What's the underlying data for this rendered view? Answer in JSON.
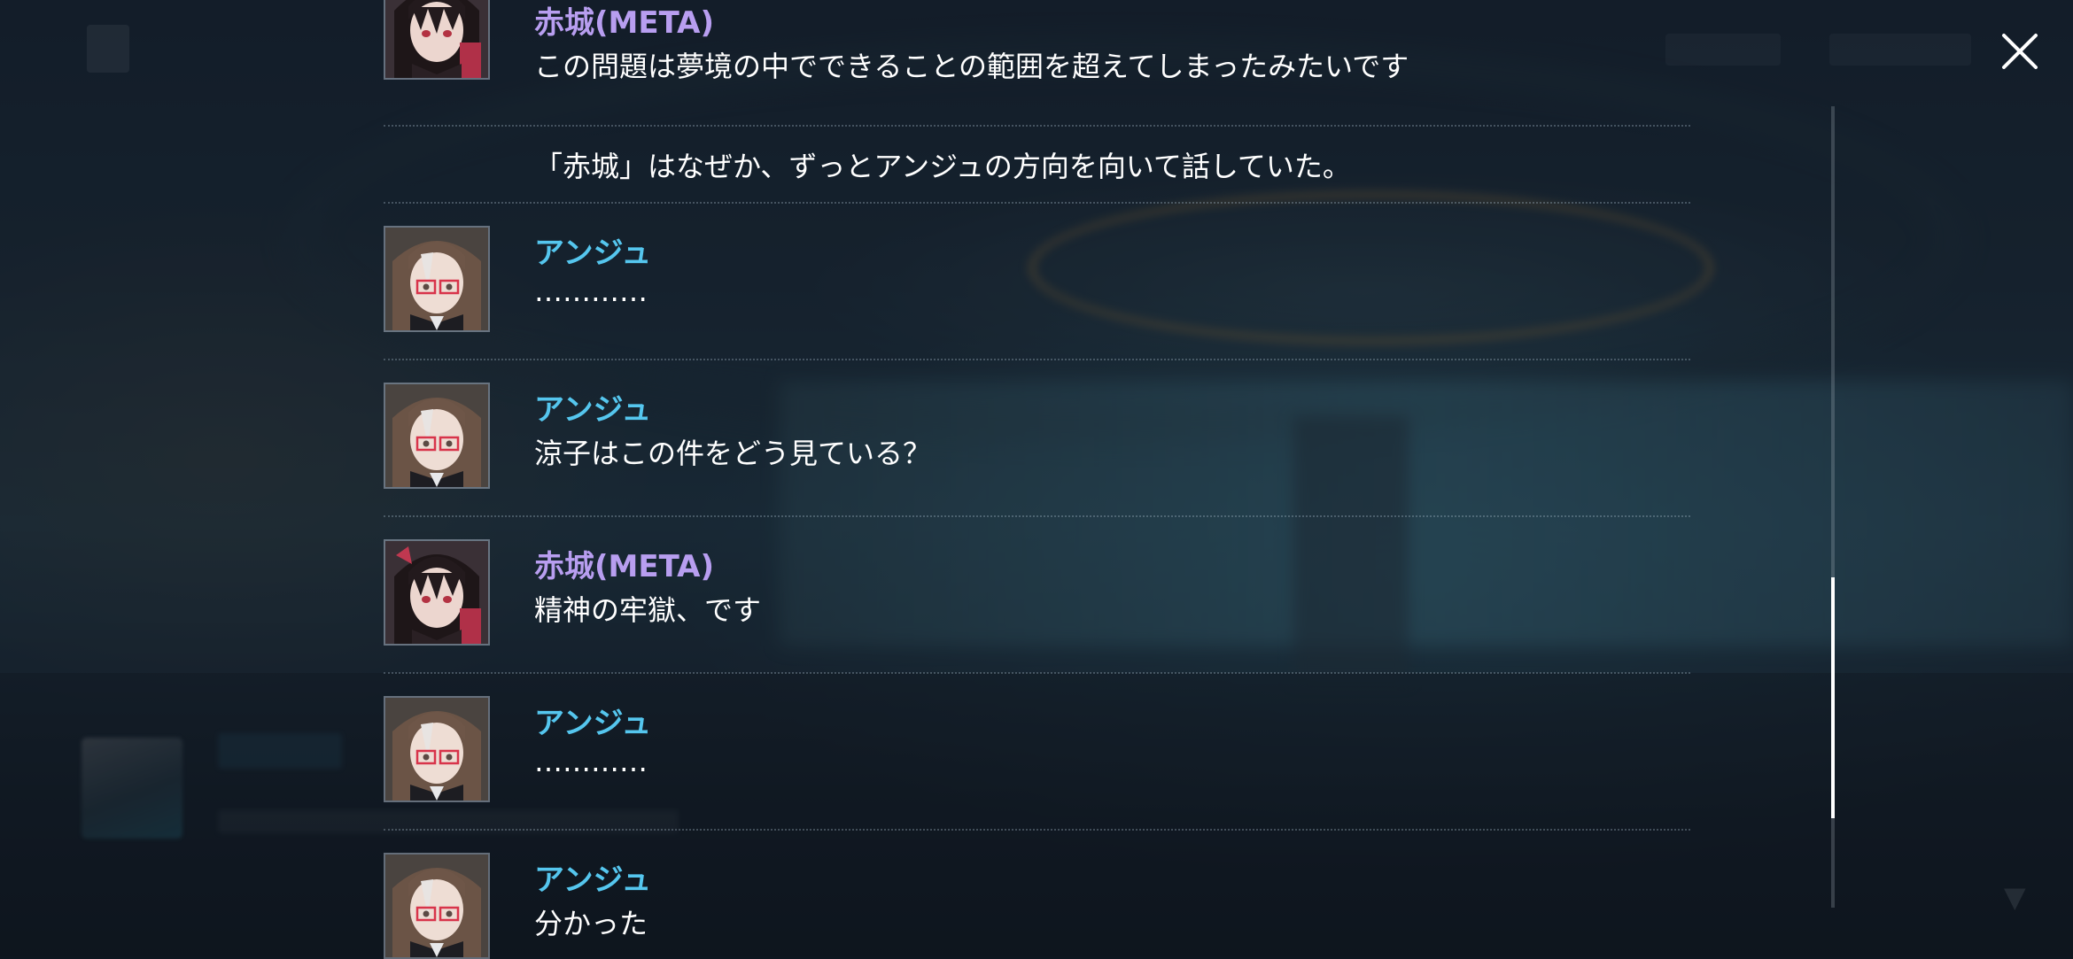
{
  "colors": {
    "akagi": "#b89ef0",
    "anju": "#55c6ee",
    "text": "#ffffff"
  },
  "close_icon": "close-icon",
  "scroll": {
    "position": 0.84,
    "visible_fraction": 0.3
  },
  "entries": [
    {
      "speaker": "赤城(META)",
      "speaker_color": "akagi",
      "portrait": "akagi-portrait",
      "text": "この問題は夢境の中でできることの範囲を超えてしまったみたいです"
    },
    {
      "speaker": "",
      "text": "「赤城」はなぜか、ずっとアンジュの方向を向いて話していた。"
    },
    {
      "speaker": "アンジュ",
      "speaker_color": "anju",
      "portrait": "anju-portrait",
      "text": "…………"
    },
    {
      "speaker": "アンジュ",
      "speaker_color": "anju",
      "portrait": "anju-portrait",
      "text": "涼子はこの件をどう見ている？"
    },
    {
      "speaker": "赤城(META)",
      "speaker_color": "akagi",
      "portrait": "akagi-portrait",
      "text": "精神の牢獄、です"
    },
    {
      "speaker": "アンジュ",
      "speaker_color": "anju",
      "portrait": "anju-portrait",
      "text": "…………"
    },
    {
      "speaker": "アンジュ",
      "speaker_color": "anju",
      "portrait": "anju-portrait",
      "text": "分かった"
    }
  ]
}
